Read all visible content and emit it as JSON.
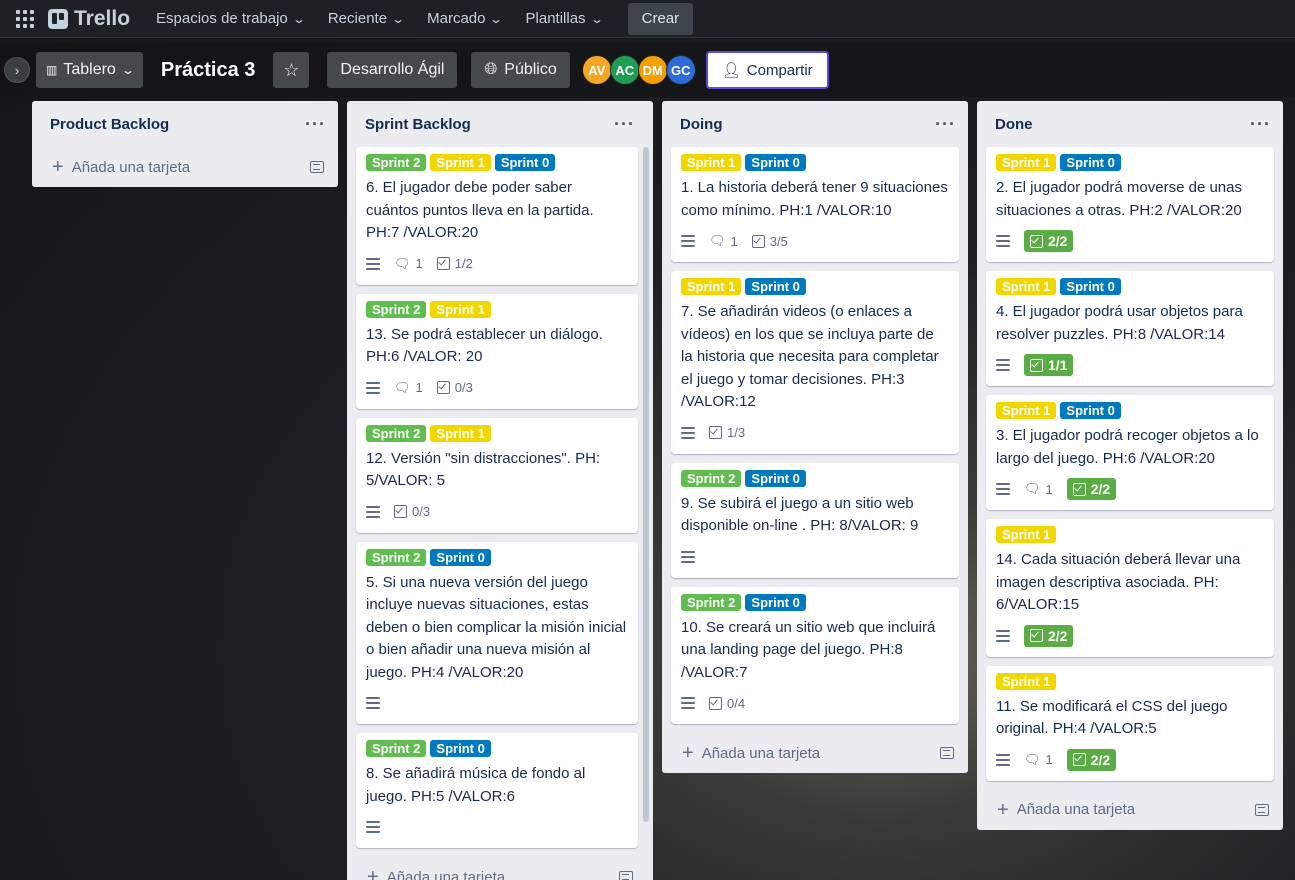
{
  "nav": {
    "logo": "Trello",
    "items": [
      "Espacios de trabajo",
      "Reciente",
      "Marcado",
      "Plantillas"
    ],
    "create_label": "Crear"
  },
  "board": {
    "view_label": "Tablero",
    "title": "Práctica 3",
    "workspace_label": "Desarrollo Ágil",
    "visibility_label": "Público",
    "share_label": "Compartir",
    "members": [
      {
        "initials": "AV",
        "color": "#f5a623"
      },
      {
        "initials": "AC",
        "color": "#1f9d55"
      },
      {
        "initials": "DM",
        "color": "#f59f00"
      },
      {
        "initials": "GC",
        "color": "#2d6bd8"
      }
    ]
  },
  "lists": [
    {
      "title": "Product Backlog",
      "add_label": "Añada una tarjeta",
      "cards": []
    },
    {
      "title": "Sprint Backlog",
      "add_label": "Añada una tarjeta",
      "cards": [
        {
          "labels": [
            {
              "text": "Sprint 2",
              "color": "green"
            },
            {
              "text": "Sprint 1",
              "color": "yellow"
            },
            {
              "text": "Sprint 0",
              "color": "blue"
            }
          ],
          "title": "6. El jugador debe poder saber cuántos puntos lleva en la partida. PH:7 /VALOR:20",
          "description": true,
          "comments": "1",
          "checklist": "1/2",
          "checklist_done": false
        },
        {
          "labels": [
            {
              "text": "Sprint 2",
              "color": "green"
            },
            {
              "text": "Sprint 1",
              "color": "yellow"
            }
          ],
          "title": "13. Se podrá establecer un diálogo. PH:6 /VALOR: 20",
          "description": true,
          "comments": "1",
          "checklist": "0/3",
          "checklist_done": false
        },
        {
          "labels": [
            {
              "text": "Sprint 2",
              "color": "green"
            },
            {
              "text": "Sprint 1",
              "color": "yellow"
            }
          ],
          "title": "12. Versión \"sin distracciones\". PH: 5/VALOR: 5",
          "description": true,
          "comments": null,
          "checklist": "0/3",
          "checklist_done": false
        },
        {
          "labels": [
            {
              "text": "Sprint 2",
              "color": "green"
            },
            {
              "text": "Sprint 0",
              "color": "blue"
            }
          ],
          "title": "5. Si una nueva versión del juego incluye nuevas situaciones, estas deben o bien complicar la misión inicial o bien añadir una nueva misión al juego. PH:4 /VALOR:20",
          "description": true,
          "comments": null,
          "checklist": null,
          "checklist_done": false
        },
        {
          "labels": [
            {
              "text": "Sprint 2",
              "color": "green"
            },
            {
              "text": "Sprint 0",
              "color": "blue"
            }
          ],
          "title": "8. Se añadirá música de fondo al juego. PH:5 /VALOR:6",
          "description": true,
          "comments": null,
          "checklist": null,
          "checklist_done": false
        }
      ]
    },
    {
      "title": "Doing",
      "add_label": "Añada una tarjeta",
      "cards": [
        {
          "labels": [
            {
              "text": "Sprint 1",
              "color": "yellow"
            },
            {
              "text": "Sprint 0",
              "color": "blue"
            }
          ],
          "title": "1. La historia deberá tener 9 situaciones como mínimo. PH:1 /VALOR:10",
          "description": true,
          "comments": "1",
          "checklist": "3/5",
          "checklist_done": false
        },
        {
          "labels": [
            {
              "text": "Sprint 1",
              "color": "yellow"
            },
            {
              "text": "Sprint 0",
              "color": "blue"
            }
          ],
          "title": "7. Se añadirán videos (o enlaces a vídeos) en los que se incluya parte de la historia que necesita para completar el juego y tomar decisiones. PH:3 /VALOR:12",
          "description": true,
          "comments": null,
          "checklist": "1/3",
          "checklist_done": false
        },
        {
          "labels": [
            {
              "text": "Sprint 2",
              "color": "green"
            },
            {
              "text": "Sprint 0",
              "color": "blue"
            }
          ],
          "title": "9. Se subirá el juego a un sitio web disponible on-line . PH: 8/VALOR: 9",
          "description": true,
          "comments": null,
          "checklist": null,
          "checklist_done": false
        },
        {
          "labels": [
            {
              "text": "Sprint 2",
              "color": "green"
            },
            {
              "text": "Sprint 0",
              "color": "blue"
            }
          ],
          "title": "10. Se creará un sitio web que incluirá una landing page del juego. PH:8 /VALOR:7",
          "description": true,
          "comments": null,
          "checklist": "0/4",
          "checklist_done": false
        }
      ]
    },
    {
      "title": "Done",
      "add_label": "Añada una tarjeta",
      "cards": [
        {
          "labels": [
            {
              "text": "Sprint 1",
              "color": "yellow"
            },
            {
              "text": "Sprint 0",
              "color": "blue"
            }
          ],
          "title": "2. El jugador podrá moverse de unas situaciones a otras. PH:2 /VALOR:20",
          "description": true,
          "comments": null,
          "checklist": "2/2",
          "checklist_done": true
        },
        {
          "labels": [
            {
              "text": "Sprint 1",
              "color": "yellow"
            },
            {
              "text": "Sprint 0",
              "color": "blue"
            }
          ],
          "title": "4. El jugador podrá usar objetos para resolver puzzles. PH:8 /VALOR:14",
          "description": true,
          "comments": null,
          "checklist": "1/1",
          "checklist_done": true
        },
        {
          "labels": [
            {
              "text": "Sprint 1",
              "color": "yellow"
            },
            {
              "text": "Sprint 0",
              "color": "blue"
            }
          ],
          "title": "3. El jugador podrá recoger objetos a lo largo del juego. PH:6 /VALOR:20",
          "description": true,
          "comments": "1",
          "checklist": "2/2",
          "checklist_done": true
        },
        {
          "labels": [
            {
              "text": "Sprint 1",
              "color": "yellow"
            }
          ],
          "title": "14. Cada situación deberá llevar una imagen descriptiva asociada. PH: 6/VALOR:15",
          "description": true,
          "comments": null,
          "checklist": "2/2",
          "checklist_done": true
        },
        {
          "labels": [
            {
              "text": "Sprint 1",
              "color": "yellow"
            }
          ],
          "title": "11. Se modificará el CSS del juego original. PH:4 /VALOR:5",
          "description": true,
          "comments": "1",
          "checklist": "2/2",
          "checklist_done": true
        }
      ]
    }
  ]
}
